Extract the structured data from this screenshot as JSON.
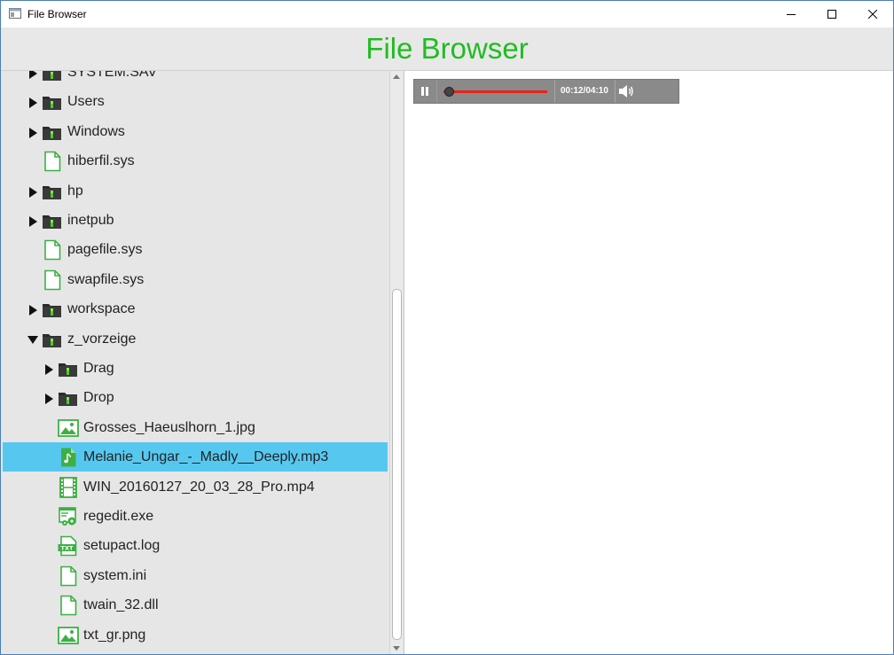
{
  "window": {
    "title": "File Browser",
    "controls": {
      "minimize": "minimize-icon",
      "maximize": "maximize-icon",
      "close": "close-icon"
    }
  },
  "header": {
    "title": "File Browser"
  },
  "tree": {
    "items": [
      {
        "label": "SYSTEM.SAV",
        "kind": "folder",
        "depth": 0,
        "expand": "collapsed"
      },
      {
        "label": "Users",
        "kind": "folder",
        "depth": 0,
        "expand": "collapsed"
      },
      {
        "label": "Windows",
        "kind": "folder",
        "depth": 0,
        "expand": "collapsed"
      },
      {
        "label": "hiberfil.sys",
        "kind": "file",
        "depth": 0
      },
      {
        "label": "hp",
        "kind": "folder",
        "depth": 0,
        "expand": "collapsed"
      },
      {
        "label": "inetpub",
        "kind": "folder",
        "depth": 0,
        "expand": "collapsed"
      },
      {
        "label": "pagefile.sys",
        "kind": "file",
        "depth": 0
      },
      {
        "label": "swapfile.sys",
        "kind": "file",
        "depth": 0
      },
      {
        "label": "workspace",
        "kind": "folder",
        "depth": 0,
        "expand": "collapsed"
      },
      {
        "label": "z_vorzeige",
        "kind": "folder",
        "depth": 0,
        "expand": "expanded"
      },
      {
        "label": "Drag",
        "kind": "folder",
        "depth": 1,
        "expand": "collapsed"
      },
      {
        "label": "Drop",
        "kind": "folder",
        "depth": 1,
        "expand": "collapsed"
      },
      {
        "label": "Grosses_Haeuslhorn_1.jpg",
        "kind": "image",
        "depth": 1
      },
      {
        "label": "Melanie_Ungar_-_Madly__Deeply.mp3",
        "kind": "audio",
        "depth": 1,
        "selected": true
      },
      {
        "label": "WIN_20160127_20_03_28_Pro.mp4",
        "kind": "video",
        "depth": 1
      },
      {
        "label": "regedit.exe",
        "kind": "exe",
        "depth": 1
      },
      {
        "label": "setupact.log",
        "kind": "txt",
        "depth": 1
      },
      {
        "label": "system.ini",
        "kind": "file",
        "depth": 1
      },
      {
        "label": "twain_32.dll",
        "kind": "file",
        "depth": 1
      },
      {
        "label": "txt_gr.png",
        "kind": "image",
        "depth": 1
      }
    ]
  },
  "player": {
    "state": "playing",
    "time": "00:12/04:10",
    "progress": 0.048,
    "icons": {
      "play": "pause-icon",
      "volume": "volume-icon"
    }
  },
  "colors": {
    "accent": "#22bb22",
    "icon_green": "#3cb043",
    "selection": "#56c8f0",
    "track_fill": "#e8231c"
  }
}
